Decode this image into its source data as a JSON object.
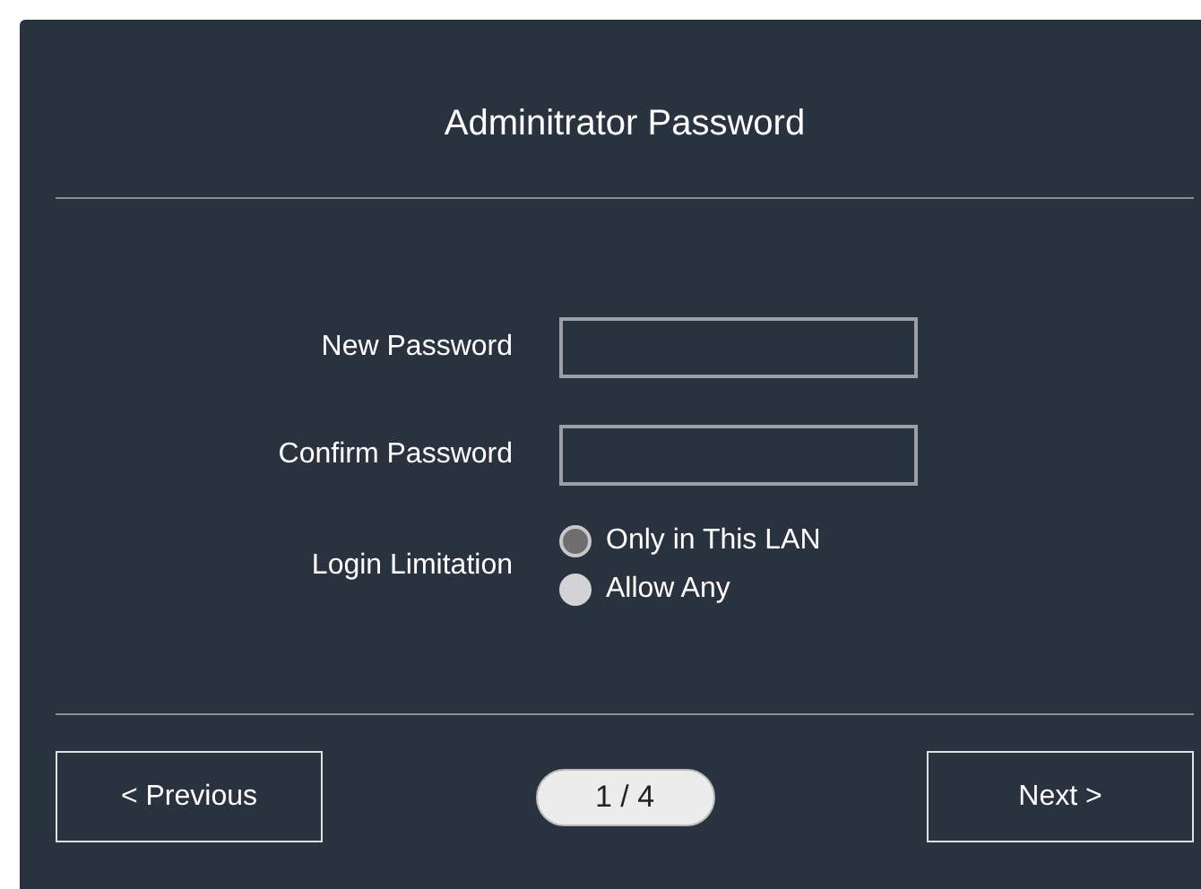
{
  "title": "Adminitrator Password",
  "fields": [
    {
      "label": "New Password"
    },
    {
      "label": "Confirm Password"
    }
  ],
  "login_limitation": {
    "label": "Login Limitation",
    "options": [
      {
        "label": "Only in This LAN",
        "selected": true
      },
      {
        "label": "Allow Any",
        "selected": false
      }
    ]
  },
  "footer": {
    "previous": "< Previous",
    "page": "1 / 4",
    "next": "Next >"
  }
}
